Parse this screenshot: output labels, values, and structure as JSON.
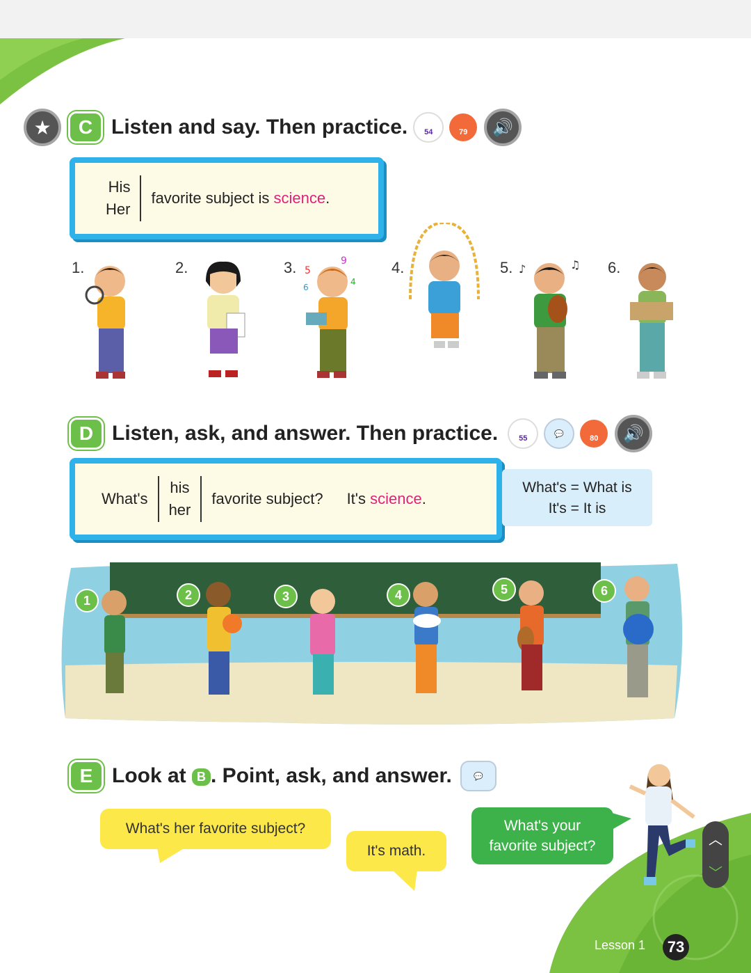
{
  "section_c": {
    "letter": "C",
    "instruction": "Listen and say. Then practice.",
    "cd_tracks": [
      "54",
      "79"
    ],
    "grammar": {
      "pronouns": [
        "His",
        "Her"
      ],
      "sentence": "favorite subject is ",
      "highlight": "science",
      "end": "."
    },
    "figure_numbers": [
      "1.",
      "2.",
      "3.",
      "4.",
      "5.",
      "6."
    ]
  },
  "section_d": {
    "letter": "D",
    "instruction": "Listen, ask, and answer. Then practice.",
    "cd_tracks": [
      "55",
      "80"
    ],
    "grammar": {
      "question_start": "What's",
      "pronouns": [
        "his",
        "her"
      ],
      "question_end": "favorite subject?",
      "answer_start": "It's ",
      "highlight": "science",
      "answer_end": "."
    },
    "note": [
      "What's = What is",
      "It's = It is"
    ],
    "scene_numbers": [
      "1",
      "2",
      "3",
      "4",
      "5",
      "6"
    ]
  },
  "section_e": {
    "letter": "E",
    "instruction_pre": "Look at ",
    "ref_letter": "B",
    "instruction_post": ". Point, ask, and answer.",
    "bubbles": [
      "What's her favorite subject?",
      "It's math.",
      "What's your favorite subject?"
    ]
  },
  "footer": {
    "lesson": "Lesson 1",
    "page_number": "73"
  },
  "colors": {
    "green": "#6cc04a",
    "blue_border": "#2fb2ea",
    "pink_highlight": "#e0207d",
    "bubble_yellow": "#fde84a",
    "bubble_green": "#3db24a"
  },
  "icons": [
    "star-icon",
    "cd-icon",
    "speaker-icon",
    "chat-icon",
    "chevron-up-icon",
    "chevron-down-icon"
  ]
}
